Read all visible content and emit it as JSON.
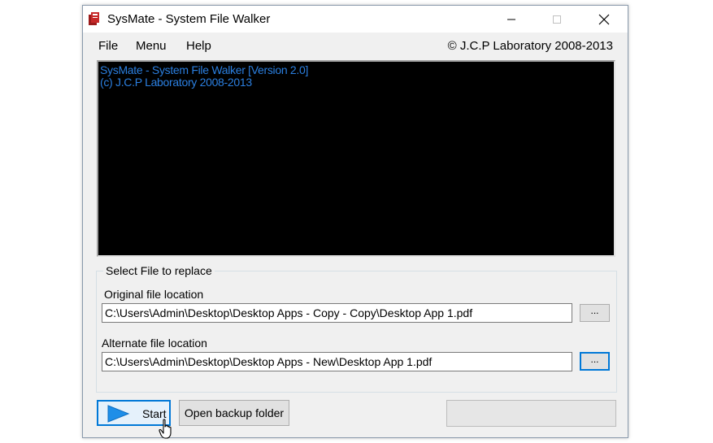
{
  "window": {
    "title": "SysMate - System File Walker",
    "controls": [
      "minimize",
      "maximize",
      "close"
    ]
  },
  "menu": {
    "items": [
      "File",
      "Menu",
      "Help"
    ],
    "copyright": "© J.C.P Laboratory 2008-2013"
  },
  "console": {
    "lines": [
      "SysMate - System File Walker [Version 2.0]",
      "(c) J.C.P Laboratory 2008-2013"
    ],
    "text_color": "#2b7fe0",
    "background": "#000000"
  },
  "file_group": {
    "label": "Select File to replace",
    "original": {
      "label": "Original file location",
      "value": "C:\\Users\\Admin\\Desktop\\Desktop Apps - Copy - Copy\\Desktop App 1.pdf",
      "browse_label": "..."
    },
    "alternate": {
      "label": "Alternate file location",
      "value": "C:\\Users\\Admin\\Desktop\\Desktop Apps - New\\Desktop App 1.pdf",
      "browse_label": "..."
    }
  },
  "actions": {
    "start_label": "Start",
    "backup_label": "Open backup folder",
    "progress": 0
  },
  "colors": {
    "accent": "#0078d7",
    "play_icon": "#1e8ee8"
  }
}
